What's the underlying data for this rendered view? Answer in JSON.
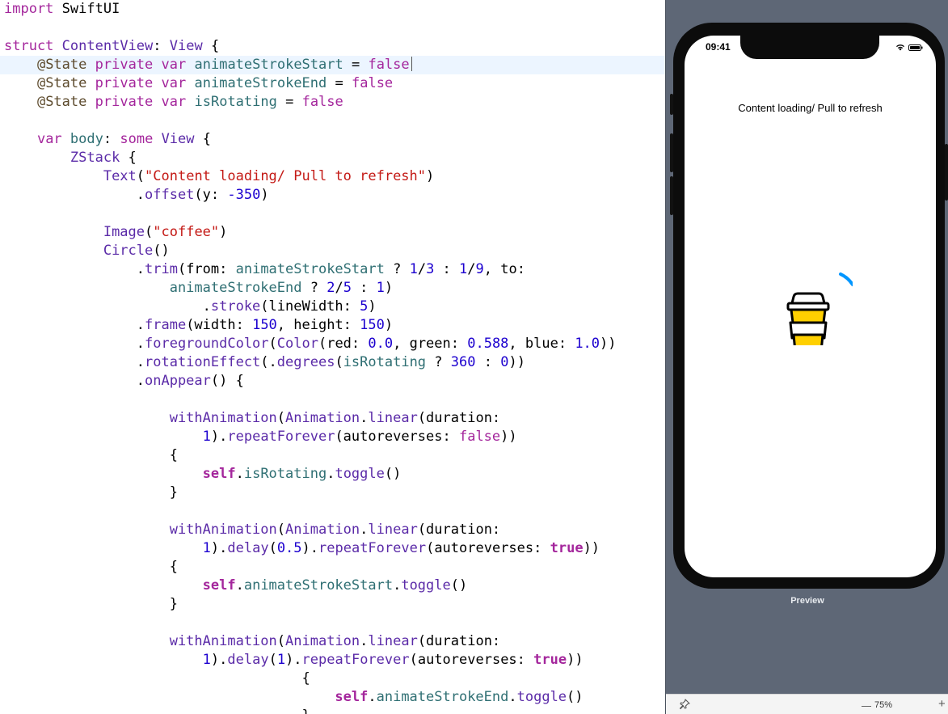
{
  "editor": {
    "lines": [
      [
        [
          "kw",
          "import"
        ],
        [
          "txt",
          " SwiftUI"
        ]
      ],
      [],
      [
        [
          "kw",
          "struct"
        ],
        [
          "txt",
          " "
        ],
        [
          "tp",
          "ContentView"
        ],
        [
          "txt",
          ": "
        ],
        [
          "tp",
          "View"
        ],
        [
          "txt",
          " {"
        ]
      ],
      [
        [
          "txt",
          "    "
        ],
        [
          "at",
          "@State"
        ],
        [
          "txt",
          " "
        ],
        [
          "kw",
          "private"
        ],
        [
          "txt",
          " "
        ],
        [
          "kw",
          "var"
        ],
        [
          "txt",
          " "
        ],
        [
          "var",
          "animateStrokeStart"
        ],
        [
          "txt",
          " = "
        ],
        [
          "kw",
          "false"
        ]
      ],
      [
        [
          "txt",
          "    "
        ],
        [
          "at",
          "@State"
        ],
        [
          "txt",
          " "
        ],
        [
          "kw",
          "private"
        ],
        [
          "txt",
          " "
        ],
        [
          "kw",
          "var"
        ],
        [
          "txt",
          " "
        ],
        [
          "var",
          "animateStrokeEnd"
        ],
        [
          "txt",
          " = "
        ],
        [
          "kw",
          "false"
        ]
      ],
      [
        [
          "txt",
          "    "
        ],
        [
          "at",
          "@State"
        ],
        [
          "txt",
          " "
        ],
        [
          "kw",
          "private"
        ],
        [
          "txt",
          " "
        ],
        [
          "kw",
          "var"
        ],
        [
          "txt",
          " "
        ],
        [
          "var",
          "isRotating"
        ],
        [
          "txt",
          " = "
        ],
        [
          "kw",
          "false"
        ]
      ],
      [],
      [
        [
          "txt",
          "    "
        ],
        [
          "kw",
          "var"
        ],
        [
          "txt",
          " "
        ],
        [
          "var",
          "body"
        ],
        [
          "txt",
          ": "
        ],
        [
          "kw",
          "some"
        ],
        [
          "txt",
          " "
        ],
        [
          "tp",
          "View"
        ],
        [
          "txt",
          " {"
        ]
      ],
      [
        [
          "txt",
          "        "
        ],
        [
          "tp",
          "ZStack"
        ],
        [
          "txt",
          " {"
        ]
      ],
      [
        [
          "txt",
          "            "
        ],
        [
          "tp",
          "Text"
        ],
        [
          "txt",
          "("
        ],
        [
          "str",
          "\"Content loading/ Pull to refresh\""
        ],
        [
          "txt",
          ")"
        ]
      ],
      [
        [
          "txt",
          "                ."
        ],
        [
          "fn",
          "offset"
        ],
        [
          "txt",
          "(y: "
        ],
        [
          "num",
          "-350"
        ],
        [
          "txt",
          ")"
        ]
      ],
      [],
      [
        [
          "txt",
          "            "
        ],
        [
          "tp",
          "Image"
        ],
        [
          "txt",
          "("
        ],
        [
          "str",
          "\"coffee\""
        ],
        [
          "txt",
          ")"
        ]
      ],
      [
        [
          "txt",
          "            "
        ],
        [
          "tp",
          "Circle"
        ],
        [
          "txt",
          "()"
        ]
      ],
      [
        [
          "txt",
          "                ."
        ],
        [
          "fn",
          "trim"
        ],
        [
          "txt",
          "(from: "
        ],
        [
          "var",
          "animateStrokeStart"
        ],
        [
          "txt",
          " ? "
        ],
        [
          "num",
          "1"
        ],
        [
          "txt",
          "/"
        ],
        [
          "num",
          "3"
        ],
        [
          "txt",
          " : "
        ],
        [
          "num",
          "1"
        ],
        [
          "txt",
          "/"
        ],
        [
          "num",
          "9"
        ],
        [
          "txt",
          ", to:"
        ]
      ],
      [
        [
          "txt",
          "                    "
        ],
        [
          "var",
          "animateStrokeEnd"
        ],
        [
          "txt",
          " ? "
        ],
        [
          "num",
          "2"
        ],
        [
          "txt",
          "/"
        ],
        [
          "num",
          "5"
        ],
        [
          "txt",
          " : "
        ],
        [
          "num",
          "1"
        ],
        [
          "txt",
          ")"
        ]
      ],
      [
        [
          "txt",
          "                        ."
        ],
        [
          "fn",
          "stroke"
        ],
        [
          "txt",
          "(lineWidth: "
        ],
        [
          "num",
          "5"
        ],
        [
          "txt",
          ")"
        ]
      ],
      [
        [
          "txt",
          "                ."
        ],
        [
          "fn",
          "frame"
        ],
        [
          "txt",
          "(width: "
        ],
        [
          "num",
          "150"
        ],
        [
          "txt",
          ", height: "
        ],
        [
          "num",
          "150"
        ],
        [
          "txt",
          ")"
        ]
      ],
      [
        [
          "txt",
          "                ."
        ],
        [
          "fn",
          "foregroundColor"
        ],
        [
          "txt",
          "("
        ],
        [
          "tp",
          "Color"
        ],
        [
          "txt",
          "(red: "
        ],
        [
          "num",
          "0.0"
        ],
        [
          "txt",
          ", green: "
        ],
        [
          "num",
          "0.588"
        ],
        [
          "txt",
          ", blue: "
        ],
        [
          "num",
          "1.0"
        ],
        [
          "txt",
          "))"
        ]
      ],
      [
        [
          "txt",
          "                ."
        ],
        [
          "fn",
          "rotationEffect"
        ],
        [
          "txt",
          "(."
        ],
        [
          "fn",
          "degrees"
        ],
        [
          "txt",
          "("
        ],
        [
          "var",
          "isRotating"
        ],
        [
          "txt",
          " ? "
        ],
        [
          "num",
          "360"
        ],
        [
          "txt",
          " : "
        ],
        [
          "num",
          "0"
        ],
        [
          "txt",
          "))"
        ]
      ],
      [
        [
          "txt",
          "                ."
        ],
        [
          "fn",
          "onAppear"
        ],
        [
          "txt",
          "() {"
        ]
      ],
      [],
      [
        [
          "txt",
          "                    "
        ],
        [
          "fn",
          "withAnimation"
        ],
        [
          "txt",
          "("
        ],
        [
          "tp",
          "Animation"
        ],
        [
          "txt",
          "."
        ],
        [
          "fn",
          "linear"
        ],
        [
          "txt",
          "(duration:"
        ]
      ],
      [
        [
          "txt",
          "                        "
        ],
        [
          "num",
          "1"
        ],
        [
          "txt",
          ")."
        ],
        [
          "fn",
          "repeatForever"
        ],
        [
          "txt",
          "(autoreverses: "
        ],
        [
          "kw",
          "false"
        ],
        [
          "txt",
          "))"
        ]
      ],
      [
        [
          "txt",
          "                    {"
        ]
      ],
      [
        [
          "txt",
          "                        "
        ],
        [
          "kwb",
          "self"
        ],
        [
          "txt",
          "."
        ],
        [
          "var",
          "isRotating"
        ],
        [
          "txt",
          "."
        ],
        [
          "fn",
          "toggle"
        ],
        [
          "txt",
          "()"
        ]
      ],
      [
        [
          "txt",
          "                    }"
        ]
      ],
      [],
      [
        [
          "txt",
          "                    "
        ],
        [
          "fn",
          "withAnimation"
        ],
        [
          "txt",
          "("
        ],
        [
          "tp",
          "Animation"
        ],
        [
          "txt",
          "."
        ],
        [
          "fn",
          "linear"
        ],
        [
          "txt",
          "(duration:"
        ]
      ],
      [
        [
          "txt",
          "                        "
        ],
        [
          "num",
          "1"
        ],
        [
          "txt",
          ")."
        ],
        [
          "fn",
          "delay"
        ],
        [
          "txt",
          "("
        ],
        [
          "num",
          "0.5"
        ],
        [
          "txt",
          ")."
        ],
        [
          "fn",
          "repeatForever"
        ],
        [
          "txt",
          "(autoreverses: "
        ],
        [
          "kwb",
          "true"
        ],
        [
          "txt",
          "))"
        ]
      ],
      [
        [
          "txt",
          "                    {"
        ]
      ],
      [
        [
          "txt",
          "                        "
        ],
        [
          "kwb",
          "self"
        ],
        [
          "txt",
          "."
        ],
        [
          "var",
          "animateStrokeStart"
        ],
        [
          "txt",
          "."
        ],
        [
          "fn",
          "toggle"
        ],
        [
          "txt",
          "()"
        ]
      ],
      [
        [
          "txt",
          "                    }"
        ]
      ],
      [],
      [
        [
          "txt",
          "                    "
        ],
        [
          "fn",
          "withAnimation"
        ],
        [
          "txt",
          "("
        ],
        [
          "tp",
          "Animation"
        ],
        [
          "txt",
          "."
        ],
        [
          "fn",
          "linear"
        ],
        [
          "txt",
          "(duration:"
        ]
      ],
      [
        [
          "txt",
          "                        "
        ],
        [
          "num",
          "1"
        ],
        [
          "txt",
          ")."
        ],
        [
          "fn",
          "delay"
        ],
        [
          "txt",
          "("
        ],
        [
          "num",
          "1"
        ],
        [
          "txt",
          ")."
        ],
        [
          "fn",
          "repeatForever"
        ],
        [
          "txt",
          "(autoreverses: "
        ],
        [
          "kwb",
          "true"
        ],
        [
          "txt",
          "))"
        ]
      ],
      [
        [
          "txt",
          "                                    {"
        ]
      ],
      [
        [
          "txt",
          "                                        "
        ],
        [
          "kwb",
          "self"
        ],
        [
          "txt",
          "."
        ],
        [
          "var",
          "animateStrokeEnd"
        ],
        [
          "txt",
          "."
        ],
        [
          "fn",
          "toggle"
        ],
        [
          "txt",
          "()"
        ]
      ],
      [
        [
          "txt",
          "                                    }"
        ]
      ]
    ]
  },
  "preview": {
    "status_time": "09:41",
    "loading_text": "Content loading/ Pull to refresh",
    "label": "Preview",
    "zoom": "75%",
    "accent_color": "#0096ff",
    "cup_color": "#ffd000"
  }
}
